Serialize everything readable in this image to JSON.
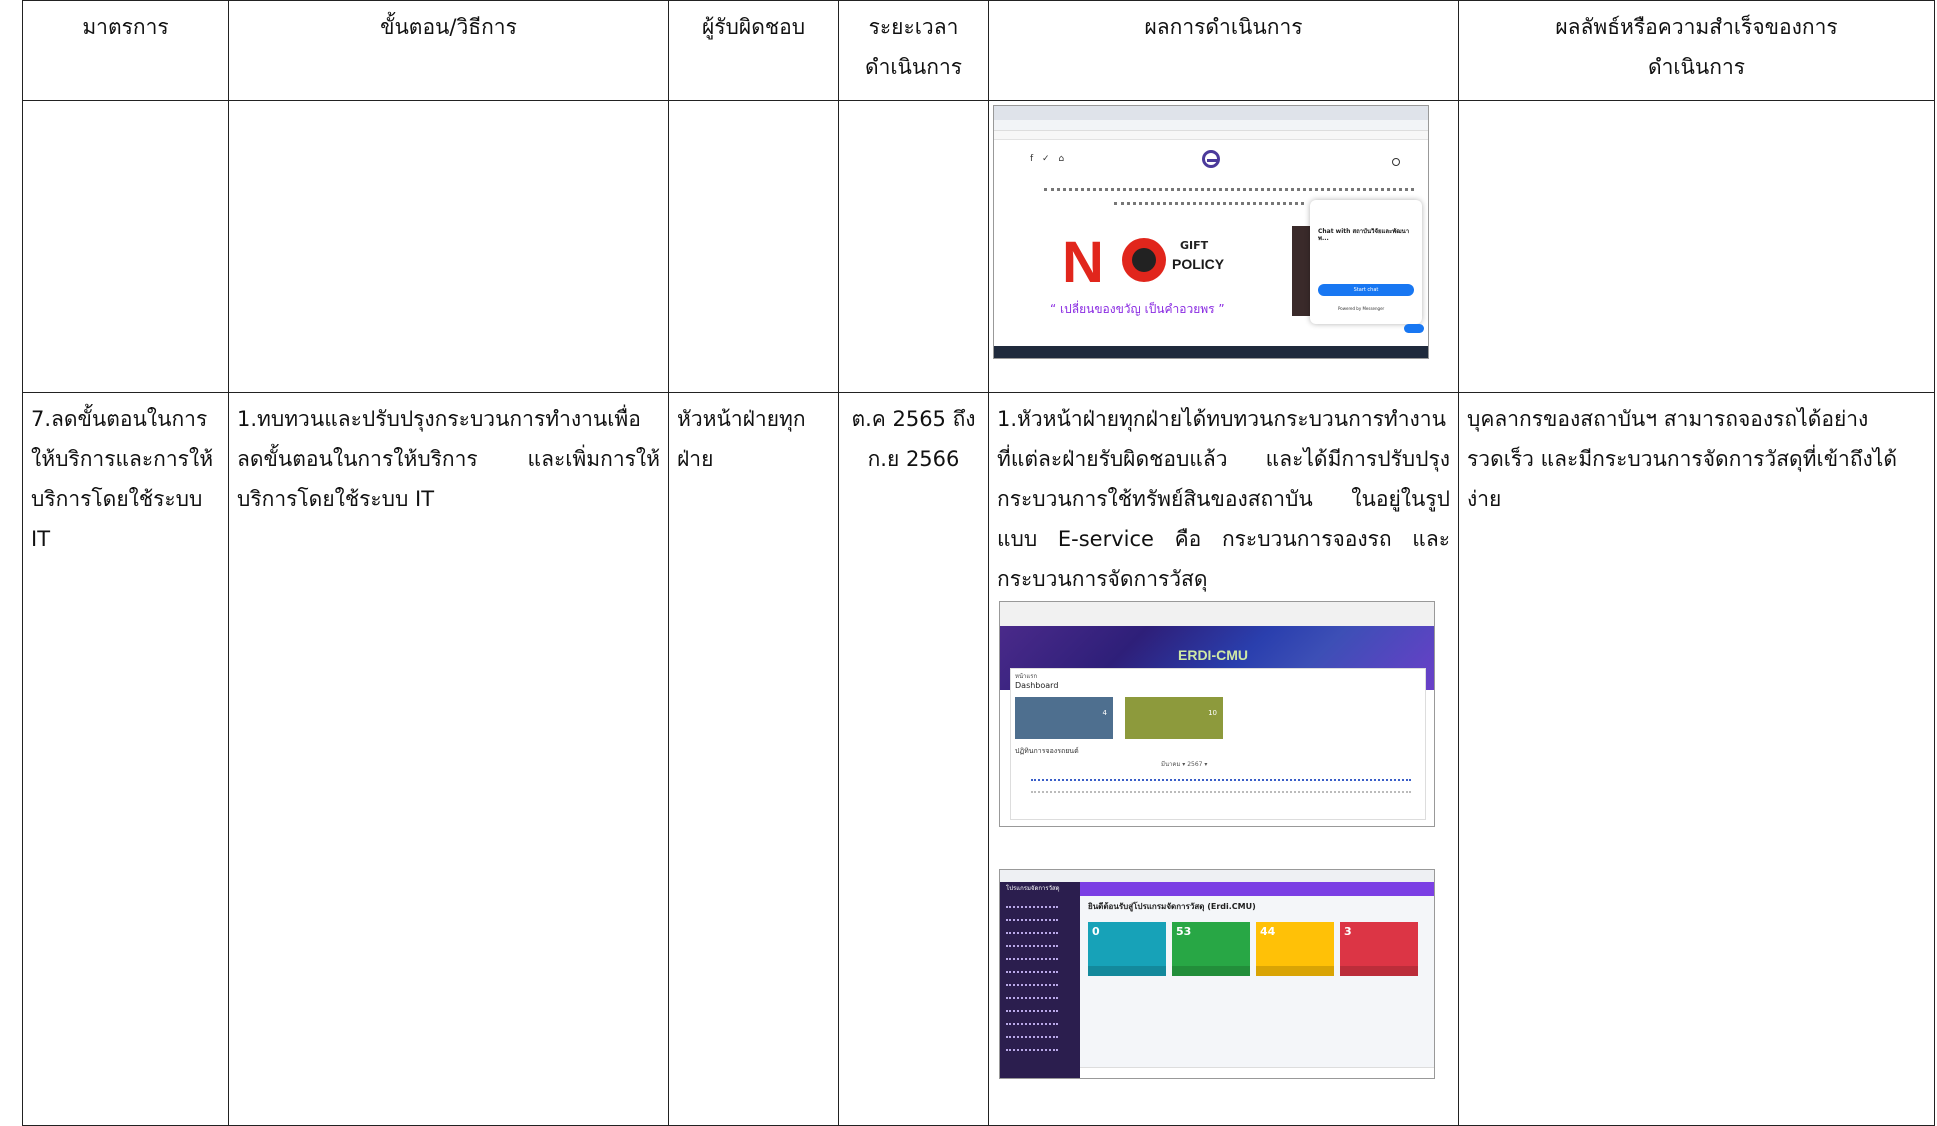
{
  "table": {
    "headers": {
      "measure": "มาตรการ",
      "steps": "ขั้นตอน/วิธีการ",
      "responsible": "ผู้รับผิดชอบ",
      "period_line1": "ระยะเวลา",
      "period_line2": "ดำเนินการ",
      "results": "ผลการดำเนินการ",
      "outcome_line1": "ผลลัพธ์หรือความสำเร็จของการ",
      "outcome_line2": "ดำเนินการ"
    },
    "row2": {
      "measure": "7.ลดขั้นตอนในการให้บริการและการให้บริการโดยใช้ระบบ IT",
      "steps": "1.ทบทวนและปรับปรุงกระบวนการทำงานเพื่อลดขั้นตอนในการให้บริการ และเพิ่มการให้บริการโดยใช้ระบบ IT",
      "responsible": "หัวหน้าฝ่ายทุกฝ่าย",
      "period": "ต.ค 2565 ถึง ก.ย 2566",
      "results": "1.หัวหน้าฝ่ายทุกฝ่ายได้ทบทวนกระบวนการทำงานที่แต่ละฝ่ายรับผิดชอบแล้ว และได้มีการปรับปรุงกระบวนการใช้ทรัพย์สินของสถาบัน ในอยู่ในรูปแบบ E-service คือ กระบวนการจองรถ และกระบวนการจัดการวัสดุ",
      "outcome": "บุคลากรของสถาบันฯ สามารถจองรถได้อย่างรวดเร็ว และมีกระบวนการจัดการวัสดุที่เข้าถึงได้ง่าย"
    }
  },
  "screenshot1": {
    "social": "f ✓ ⌂",
    "gift": "GIFT",
    "policy": "POLICY",
    "slogan": "“ เปลี่ยนของขวัญ เป็นคำอวยพร ”",
    "chat_title": "Chat with สถาบันวิจัยและพัฒนาพ...",
    "chat_start": "Start chat",
    "chat_powered": "Powered by Messenger"
  },
  "screenshot2": {
    "brand": "ERDI-CMU",
    "breadcrumb": "หน้าแรก",
    "dashboard": "Dashboard",
    "card_a_value": "4",
    "card_b_value": "10",
    "calendar_title": "ปฏิทินการจองรถยนต์",
    "calendar_month": "มีนาคม ▾ 2567 ▾"
  },
  "screenshot3": {
    "brand": "โปรแกรมจัดการวัสดุ",
    "welcome": "ยินดีต้อนรับสู่โปรแกรมจัดการวัสดุ (Erdi.CMU)",
    "box1": "0",
    "box2": "53",
    "box3": "44",
    "box4": "3"
  },
  "colors": {
    "nosign_red": "#e1261c",
    "slogan_purple": "#8a2be2",
    "card_blue": "#4e6f8f",
    "card_olive": "#8d9a3c",
    "box_teal": "#17a2b8",
    "box_green": "#28a745",
    "box_yellow": "#ffc107",
    "box_red": "#dc3545"
  }
}
